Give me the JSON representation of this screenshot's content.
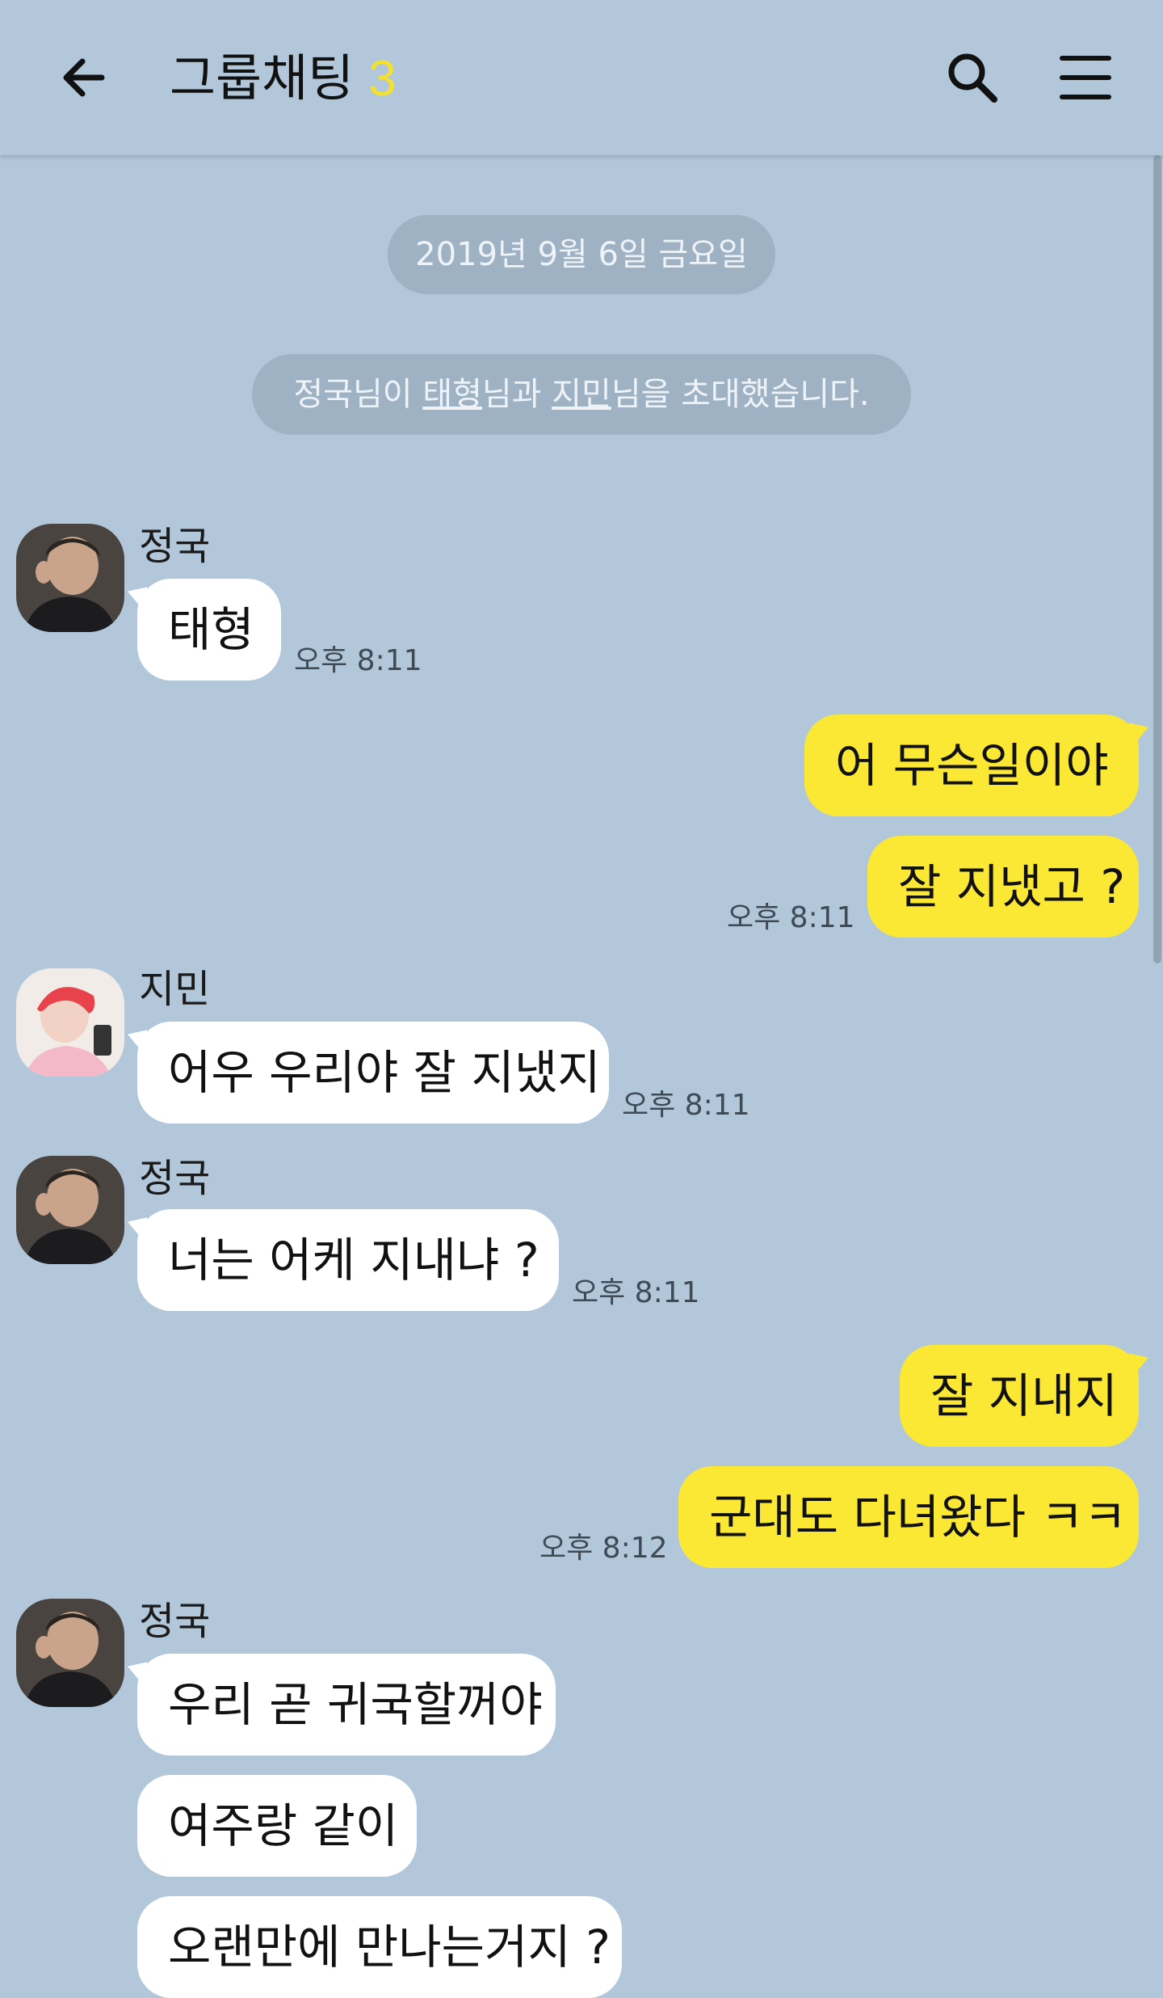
{
  "header": {
    "title": "그룹채팅",
    "member_count": "3",
    "back_icon": "arrow-left-icon",
    "search_icon": "search-icon",
    "menu_icon": "hamburger-menu-icon"
  },
  "chat": {
    "date_divider": "2019년 9월 6일 금요일",
    "notice": {
      "prefix": "정국님이 ",
      "name1": "태형",
      "middle": "님과 ",
      "name2": "지민",
      "suffix": "님을 초대했습니다."
    },
    "messages": [
      {
        "sender": "정국",
        "text": "태형",
        "time": "오후 8:11"
      },
      {
        "text": "어 무슨일이야"
      },
      {
        "text": "잘 지냈고 ?",
        "time": "오후 8:11"
      },
      {
        "sender": "지민",
        "text": "어우 우리야 잘 지냈지",
        "time": "오후 8:11"
      },
      {
        "sender": "정국",
        "text": "너는  어케 지내냐 ?",
        "time": "오후 8:11"
      },
      {
        "text": "잘 지내지"
      },
      {
        "text": "군대도 다녀왔다 ㅋㅋ",
        "time": "오후 8:12"
      },
      {
        "sender": "정국",
        "text": "우리 곧 귀국할꺼야"
      },
      {
        "text": "여주랑 같이"
      },
      {
        "text": "오랜만에 만나는거지 ?"
      }
    ]
  },
  "colors": {
    "background": "#b2c7da",
    "incoming_bubble": "#ffffff",
    "outgoing_bubble": "#fbe835",
    "member_count": "#f5e12b",
    "system_pill": "#9fb2c4"
  }
}
